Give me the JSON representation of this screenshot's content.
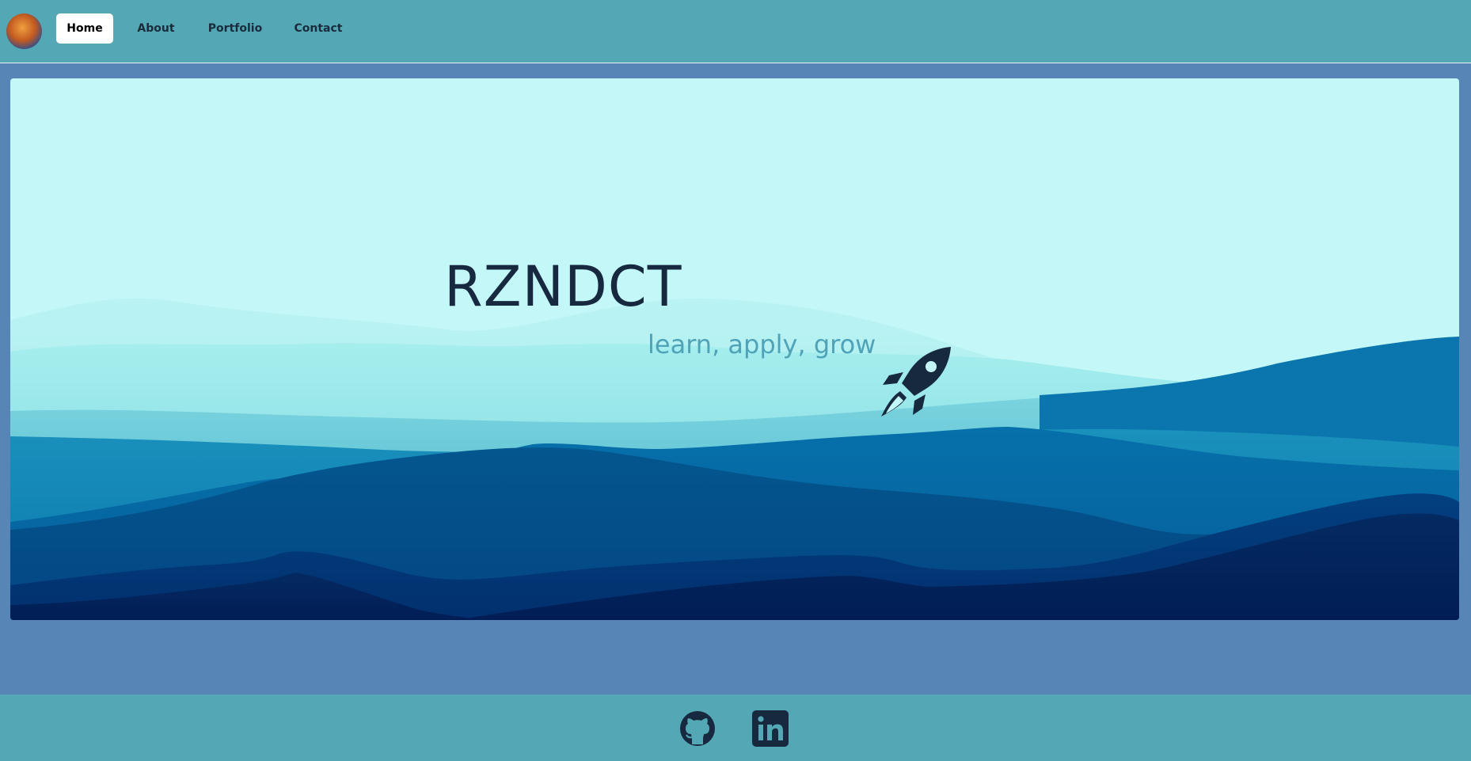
{
  "nav": {
    "items": [
      {
        "label": "Home",
        "active": true
      },
      {
        "label": "About",
        "active": false
      },
      {
        "label": "Portfolio",
        "active": false
      },
      {
        "label": "Contact",
        "active": false
      }
    ]
  },
  "hero": {
    "title": "RZNDCT",
    "tagline": "learn, apply, grow",
    "icon": "rocket-icon"
  },
  "footer": {
    "links": [
      {
        "icon": "github-icon"
      },
      {
        "icon": "linkedin-icon"
      }
    ]
  },
  "colors": {
    "header_bg": "#54a8b5",
    "page_bg": "#5786b6",
    "hero_sky": "#c4f7f8",
    "title": "#16293f",
    "tagline": "#4fa3b8"
  }
}
